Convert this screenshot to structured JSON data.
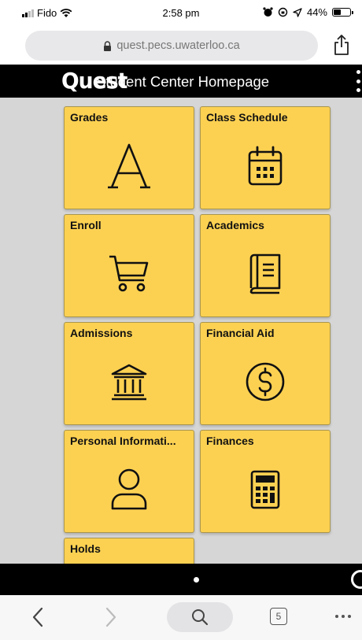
{
  "status_bar": {
    "carrier": "Fido",
    "time": "2:58 pm",
    "battery": "44%",
    "battery_level": 0.44
  },
  "browser": {
    "url": "quest.pecs.uwaterloo.ca",
    "tab_count": "5"
  },
  "header": {
    "logo": "Quest",
    "title": "Student Center Homepage"
  },
  "tiles": [
    {
      "label": "Grades",
      "icon": "letter-a-icon"
    },
    {
      "label": "Class Schedule",
      "icon": "calendar-icon"
    },
    {
      "label": "Enroll",
      "icon": "cart-icon"
    },
    {
      "label": "Academics",
      "icon": "book-icon"
    },
    {
      "label": "Admissions",
      "icon": "institution-icon"
    },
    {
      "label": "Financial Aid",
      "icon": "dollar-icon"
    },
    {
      "label": "Personal Informati...",
      "icon": "person-icon"
    },
    {
      "label": "Finances",
      "icon": "calculator-icon"
    },
    {
      "label": "Holds",
      "icon": ""
    }
  ],
  "colors": {
    "tile": "#fcd152",
    "header": "#000000",
    "content_bg": "#d6d6d6"
  }
}
